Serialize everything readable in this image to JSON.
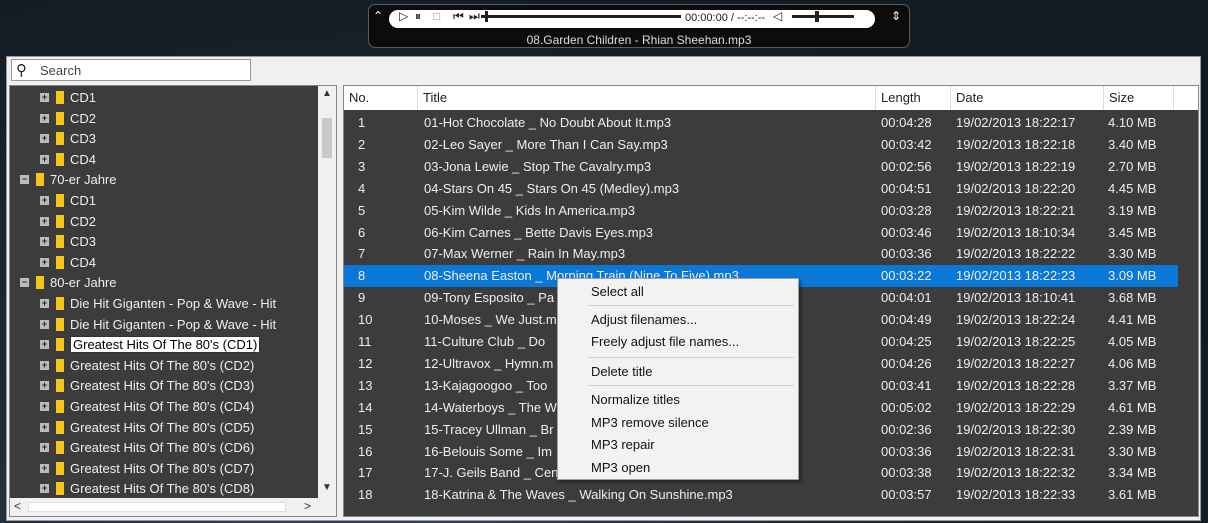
{
  "player": {
    "time": "00:00:00 / --:--:--",
    "track": "08.Garden Children - Rhian Sheehan.mp3"
  },
  "search": {
    "placeholder": "Search"
  },
  "tree": {
    "items": [
      {
        "label": "CD1",
        "level": 2
      },
      {
        "label": "CD2",
        "level": 2
      },
      {
        "label": "CD3",
        "level": 2
      },
      {
        "label": "CD4",
        "level": 2
      },
      {
        "label": "70-er Jahre",
        "level": 1,
        "expanded": true
      },
      {
        "label": "CD1",
        "level": 2
      },
      {
        "label": "CD2",
        "level": 2
      },
      {
        "label": "CD3",
        "level": 2
      },
      {
        "label": "CD4",
        "level": 2
      },
      {
        "label": "80-er Jahre",
        "level": 1,
        "expanded": true
      },
      {
        "label": "Die Hit Giganten - Pop & Wave - Hit",
        "level": 2
      },
      {
        "label": "Die Hit Giganten - Pop & Wave - Hit",
        "level": 2
      },
      {
        "label": "Greatest Hits Of The 80's (CD1)",
        "level": 2,
        "selected": true
      },
      {
        "label": "Greatest Hits Of The 80's (CD2)",
        "level": 2
      },
      {
        "label": "Greatest Hits Of The 80's (CD3)",
        "level": 2
      },
      {
        "label": "Greatest Hits Of The 80's (CD4)",
        "level": 2
      },
      {
        "label": "Greatest Hits Of The 80's (CD5)",
        "level": 2
      },
      {
        "label": "Greatest Hits Of The 80's (CD6)",
        "level": 2
      },
      {
        "label": "Greatest Hits Of The 80's (CD7)",
        "level": 2
      },
      {
        "label": "Greatest Hits Of The 80's (CD8)",
        "level": 2
      }
    ]
  },
  "table": {
    "columns": [
      "No.",
      "Title",
      "Length",
      "Date",
      "Size"
    ],
    "rows": [
      [
        "1",
        "01-Hot Chocolate _ No Doubt About It.mp3",
        "00:04:28",
        "19/02/2013 18:22:17",
        "4.10 MB"
      ],
      [
        "2",
        "02-Leo Sayer _ More Than I Can Say.mp3",
        "00:03:42",
        "19/02/2013 18:22:18",
        "3.40 MB"
      ],
      [
        "3",
        "03-Jona Lewie _ Stop The Cavalry.mp3",
        "00:02:56",
        "19/02/2013 18:22:19",
        "2.70 MB"
      ],
      [
        "4",
        "04-Stars On 45 _ Stars On 45 (Medley).mp3",
        "00:04:51",
        "19/02/2013 18:22:20",
        "4.45 MB"
      ],
      [
        "5",
        "05-Kim Wilde _ Kids In America.mp3",
        "00:03:28",
        "19/02/2013 18:22:21",
        "3.19 MB"
      ],
      [
        "6",
        "06-Kim Carnes _ Bette Davis Eyes.mp3",
        "00:03:46",
        "19/02/2013 18:10:34",
        "3.45 MB"
      ],
      [
        "7",
        "07-Max Werner _ Rain In May.mp3",
        "00:03:36",
        "19/02/2013 18:22:22",
        "3.30 MB"
      ],
      [
        "8",
        "08-Sheena Easton _ Morning Train (Nine To Five).mp3",
        "00:03:22",
        "19/02/2013 18:22:23",
        "3.09 MB"
      ],
      [
        "9",
        "09-Tony Esposito _ Pa",
        "00:04:01",
        "19/02/2013 18:10:41",
        "3.68 MB"
      ],
      [
        "10",
        "10-Moses _ We Just.m",
        "00:04:49",
        "19/02/2013 18:22:24",
        "4.41 MB"
      ],
      [
        "11",
        "11-Culture Club _ Do",
        "00:04:25",
        "19/02/2013 18:22:25",
        "4.05 MB"
      ],
      [
        "12",
        "12-Ultravox _ Hymn.m",
        "00:04:26",
        "19/02/2013 18:22:27",
        "4.06 MB"
      ],
      [
        "13",
        "13-Kajagoogoo _ Too",
        "00:03:41",
        "19/02/2013 18:22:28",
        "3.37 MB"
      ],
      [
        "14",
        "14-Waterboys _ The W",
        "00:05:02",
        "19/02/2013 18:22:29",
        "4.61 MB"
      ],
      [
        "15",
        "15-Tracey Ullman _ Br",
        "00:02:36",
        "19/02/2013 18:22:30",
        "2.39 MB"
      ],
      [
        "16",
        "16-Belouis Some _ Im",
        "00:03:36",
        "19/02/2013 18:22:31",
        "3.30 MB"
      ],
      [
        "17",
        "17-J. Geils Band _ Centerfold.mp3",
        "00:03:38",
        "19/02/2013 18:22:32",
        "3.34 MB"
      ],
      [
        "18",
        "18-Katrina & The Waves _ Walking On Sunshine.mp3",
        "00:03:57",
        "19/02/2013 18:22:33",
        "3.61 MB"
      ]
    ],
    "selected_row": 7
  },
  "context_menu": {
    "items": [
      "Select all",
      "Adjust filenames...",
      "Freely adjust file names...",
      "Delete title",
      "Normalize titles",
      "MP3 remove silence",
      "MP3 repair",
      "MP3 open"
    ]
  },
  "colors": {
    "selection": "#0a78d7",
    "panel": "#3c3c3c",
    "folder": "#f5c518"
  }
}
